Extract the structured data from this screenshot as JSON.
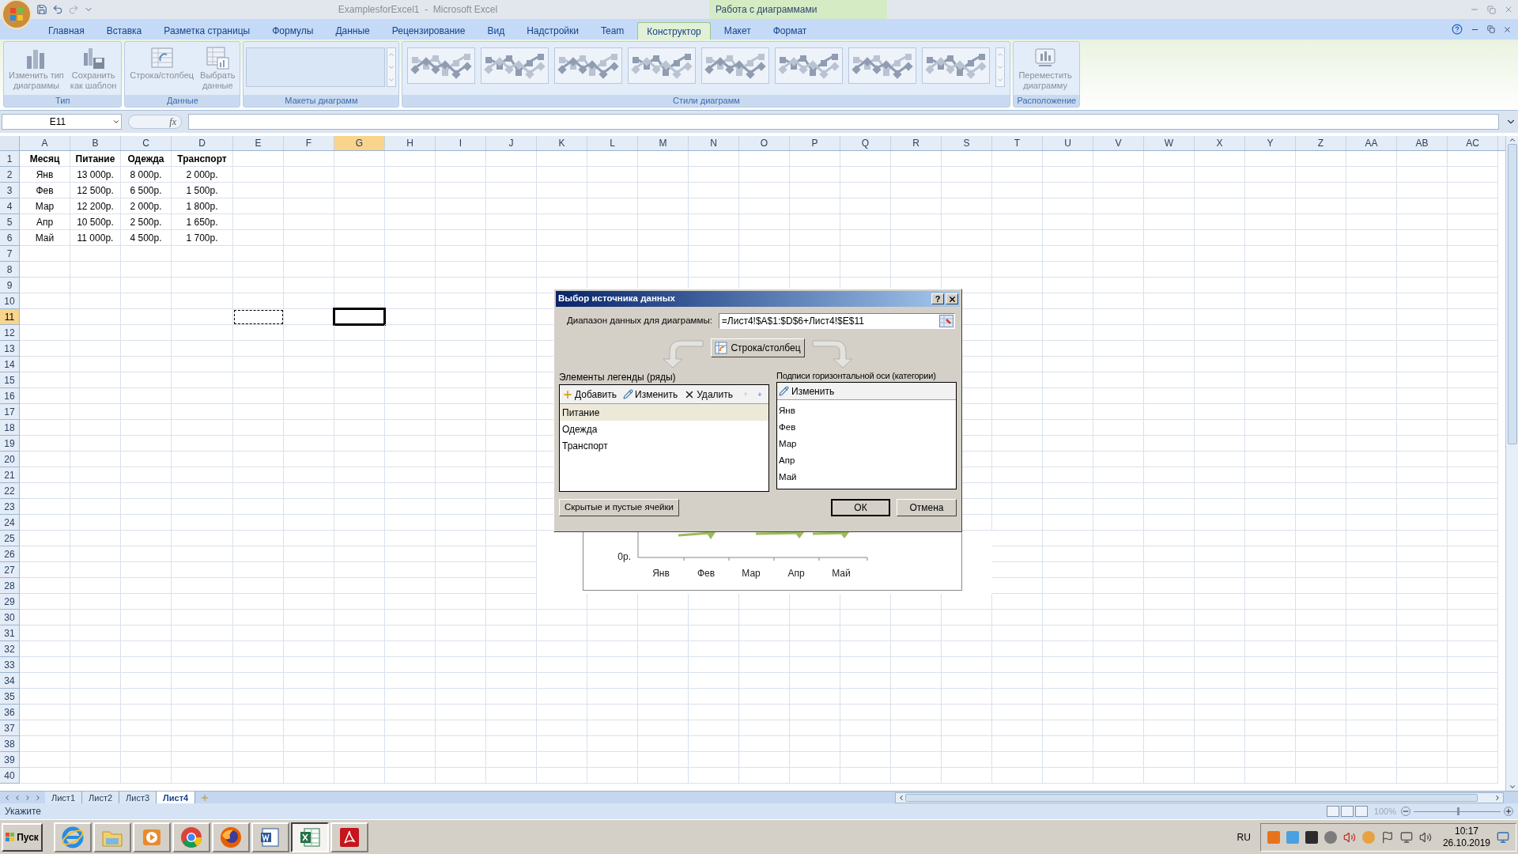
{
  "window": {
    "title": "ExamplesforExcel1  -  Microsoft Excel",
    "context_title": "Работа с диаграммами"
  },
  "tabs": [
    {
      "label": "Главная",
      "selected": false
    },
    {
      "label": "Вставка",
      "selected": false
    },
    {
      "label": "Разметка страницы",
      "selected": false
    },
    {
      "label": "Формулы",
      "selected": false
    },
    {
      "label": "Данные",
      "selected": false
    },
    {
      "label": "Рецензирование",
      "selected": false
    },
    {
      "label": "Вид",
      "selected": false
    },
    {
      "label": "Надстройки",
      "selected": false
    },
    {
      "label": "Team",
      "selected": false
    },
    {
      "label": "Конструктор",
      "selected": true
    },
    {
      "label": "Макет",
      "selected": false
    },
    {
      "label": "Формат",
      "selected": false
    }
  ],
  "ribbon": {
    "groups": [
      {
        "label": "Тип",
        "kind": "buttons",
        "buttons": [
          {
            "kind": "type",
            "lines": [
              "Изменить тип",
              "диаграммы"
            ],
            "disabled": true
          },
          {
            "kind": "template",
            "lines": [
              "Сохранить",
              "как шаблон"
            ],
            "disabled": true
          }
        ]
      },
      {
        "label": "Данные",
        "kind": "buttons",
        "buttons": [
          {
            "kind": "switch",
            "lines": [
              "Строка/столбец"
            ],
            "disabled": true
          },
          {
            "kind": "select",
            "lines": [
              "Выбрать",
              "данные"
            ],
            "disabled": true
          }
        ]
      },
      {
        "label": "Макеты диаграмм",
        "kind": "layouts"
      },
      {
        "label": "Стили диаграмм",
        "kind": "styles"
      },
      {
        "label": "Расположение",
        "kind": "buttons",
        "buttons": [
          {
            "kind": "move",
            "lines": [
              "Переместить",
              "диаграмму"
            ],
            "disabled": true
          }
        ]
      }
    ]
  },
  "formula_bar": {
    "name_box": "E11",
    "fx": "fx"
  },
  "sheet": {
    "columns": [
      {
        "label": "A",
        "selected": false,
        "marquee": false
      },
      {
        "label": "B",
        "selected": false,
        "marquee": false
      },
      {
        "label": "C",
        "selected": false,
        "marquee": false
      },
      {
        "label": "D",
        "selected": false,
        "marquee": false
      },
      {
        "label": "E",
        "selected": false,
        "marquee": true
      },
      {
        "label": "F",
        "selected": false,
        "marquee": false
      },
      {
        "label": "G",
        "selected": true,
        "marquee": false
      },
      {
        "label": "H",
        "selected": false,
        "marquee": false
      },
      {
        "label": "I",
        "selected": false,
        "marquee": false
      },
      {
        "label": "J",
        "selected": false,
        "marquee": false
      },
      {
        "label": "K",
        "selected": false,
        "marquee": false
      },
      {
        "label": "L",
        "selected": false,
        "marquee": false
      },
      {
        "label": "M",
        "selected": false,
        "marquee": false
      },
      {
        "label": "N",
        "selected": false,
        "marquee": false
      },
      {
        "label": "O",
        "selected": false,
        "marquee": false
      },
      {
        "label": "P",
        "selected": false,
        "marquee": false
      },
      {
        "label": "Q",
        "selected": false,
        "marquee": false
      },
      {
        "label": "R",
        "selected": false,
        "marquee": false
      },
      {
        "label": "S",
        "selected": false,
        "marquee": false
      },
      {
        "label": "T",
        "selected": false,
        "marquee": false
      },
      {
        "label": "U",
        "selected": false,
        "marquee": false
      },
      {
        "label": "V",
        "selected": false,
        "marquee": false
      },
      {
        "label": "W",
        "selected": false,
        "marquee": false
      },
      {
        "label": "X",
        "selected": false,
        "marquee": false
      },
      {
        "label": "Y",
        "selected": false,
        "marquee": false
      },
      {
        "label": "Z",
        "selected": false,
        "marquee": false
      },
      {
        "label": "AA",
        "selected": false,
        "marquee": false
      },
      {
        "label": "AB",
        "selected": false,
        "marquee": false
      },
      {
        "label": "AC",
        "selected": false,
        "marquee": false
      }
    ],
    "rows": [
      {
        "label": "1",
        "selected": false
      },
      {
        "label": "2",
        "selected": false
      },
      {
        "label": "3",
        "selected": false
      },
      {
        "label": "4",
        "selected": false
      },
      {
        "label": "5",
        "selected": false
      },
      {
        "label": "6",
        "selected": false
      },
      {
        "label": "7",
        "selected": false
      },
      {
        "label": "8",
        "selected": false
      },
      {
        "label": "9",
        "selected": false
      },
      {
        "label": "10",
        "selected": false
      },
      {
        "label": "11",
        "selected": true
      },
      {
        "label": "12",
        "selected": false
      },
      {
        "label": "13",
        "selected": false
      },
      {
        "label": "14",
        "selected": false
      },
      {
        "label": "15",
        "selected": false
      },
      {
        "label": "16",
        "selected": false
      },
      {
        "label": "17",
        "selected": false
      },
      {
        "label": "18",
        "selected": false
      },
      {
        "label": "19",
        "selected": false
      },
      {
        "label": "20",
        "selected": false
      },
      {
        "label": "21",
        "selected": false
      },
      {
        "label": "22",
        "selected": false
      },
      {
        "label": "23",
        "selected": false
      },
      {
        "label": "24",
        "selected": false
      },
      {
        "label": "25",
        "selected": false
      },
      {
        "label": "26",
        "selected": false
      },
      {
        "label": "27",
        "selected": false
      },
      {
        "label": "28",
        "selected": false
      },
      {
        "label": "29",
        "selected": false
      },
      {
        "label": "30",
        "selected": false
      },
      {
        "label": "31",
        "selected": false
      },
      {
        "label": "32",
        "selected": false
      },
      {
        "label": "33",
        "selected": false
      },
      {
        "label": "34",
        "selected": false
      },
      {
        "label": "35",
        "selected": false
      },
      {
        "label": "36",
        "selected": false
      },
      {
        "label": "37",
        "selected": false
      },
      {
        "label": "38",
        "selected": false
      },
      {
        "label": "39",
        "selected": false
      },
      {
        "label": "40",
        "selected": false
      }
    ],
    "header": [
      "Месяц",
      "Питание",
      "Одежда",
      "Транспорт"
    ],
    "data": [
      [
        "Янв",
        "13 000р.",
        "8 000р.",
        "2 000р."
      ],
      [
        "Фев",
        "12 500р.",
        "6 500р.",
        "1 500р."
      ],
      [
        "Мар",
        "12 200р.",
        "2 000р.",
        "1 800р."
      ],
      [
        "Апр",
        "10 500р.",
        "2 500р.",
        "1 650р."
      ],
      [
        "Май",
        "11 000р.",
        "4 500р.",
        "1 700р."
      ]
    ]
  },
  "chart": {
    "y_tick": "0р.",
    "categories": [
      "Янв",
      "Фев",
      "Мар",
      "Апр",
      "Май"
    ]
  },
  "dialog": {
    "title": "Выбор источника данных",
    "help": "?",
    "range_label": "Диапазон данных для диаграммы:",
    "range_value": "=Лист4!$A$1:$D$6+Лист4!$E$11",
    "switch_button": "Строка/столбец",
    "legend_title": "Элементы легенды (ряды)",
    "legend_tools": [
      {
        "kind": "add",
        "label": "Добавить"
      },
      {
        "kind": "edit",
        "label": "Изменить"
      },
      {
        "kind": "delete",
        "label": "Удалить"
      }
    ],
    "move_up": {
      "disabled": true
    },
    "move_down": {
      "disabled": false
    },
    "series": [
      {
        "label": "Питание",
        "selected": true
      },
      {
        "label": "Одежда",
        "selected": false
      },
      {
        "label": "Транспорт",
        "selected": false
      }
    ],
    "axis_title": "Подписи горизонтальной оси (категории)",
    "axis_edit": "Изменить",
    "categories": [
      "Янв",
      "Фев",
      "Мар",
      "Апр",
      "Май"
    ],
    "hidden_cells_button": "Скрытые и пустые ячейки",
    "ok_button": "ОК",
    "cancel_button": "Отмена"
  },
  "sheet_tabs": [
    {
      "label": "Лист1",
      "selected": false
    },
    {
      "label": "Лист2",
      "selected": false
    },
    {
      "label": "Лист3",
      "selected": false
    },
    {
      "label": "Лист4",
      "selected": true
    }
  ],
  "status_bar": {
    "mode": "Укажите",
    "zoom": "100%",
    "zoom_slider": {
      "level": 0.5
    }
  },
  "taskbar": {
    "start": "Пуск",
    "apps": [
      {
        "kind": "ie",
        "selected": false
      },
      {
        "kind": "folder",
        "selected": false
      },
      {
        "kind": "media",
        "selected": false
      },
      {
        "kind": "chrome",
        "selected": false
      },
      {
        "kind": "firefox",
        "selected": false
      },
      {
        "kind": "word",
        "selected": false
      },
      {
        "kind": "excel",
        "selected": true
      },
      {
        "kind": "acrobat",
        "selected": false
      }
    ],
    "language": "RU",
    "time": "10:17",
    "date": "26.10.2019"
  }
}
